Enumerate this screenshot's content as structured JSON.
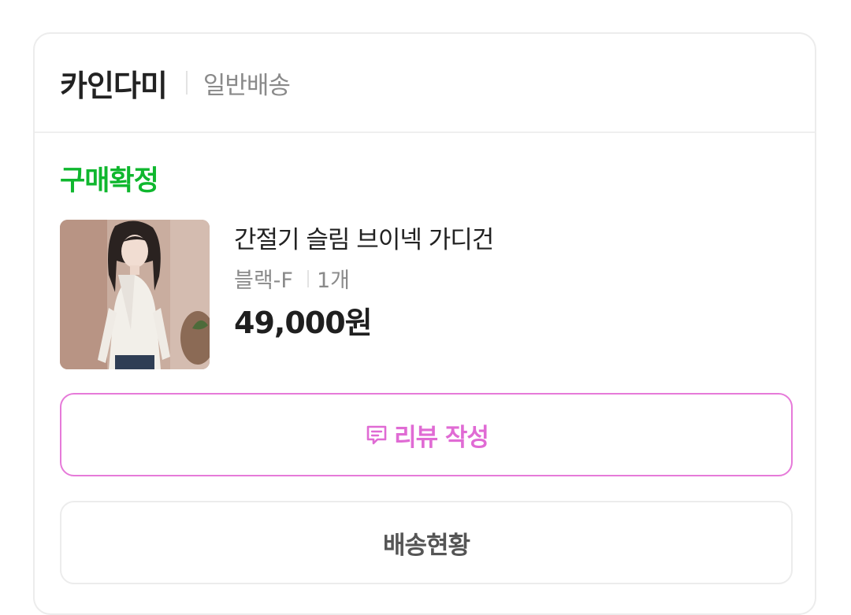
{
  "order_card": {
    "seller_name": "카인다미",
    "shipping_type": "일반배송",
    "status": "구매확정",
    "product": {
      "name": "간절기 슬림 브이넥 가디건",
      "option": "블랙-F",
      "quantity": "1개",
      "price": "49,000원",
      "image_icon": "product-photo"
    },
    "buttons": {
      "review_label": "리뷰 작성",
      "review_icon": "comment-edit-icon",
      "tracking_label": "배송현황"
    }
  },
  "colors": {
    "status_green": "#0fb72e",
    "review_pink": "#e06bd4",
    "border_gray": "#ececec"
  }
}
